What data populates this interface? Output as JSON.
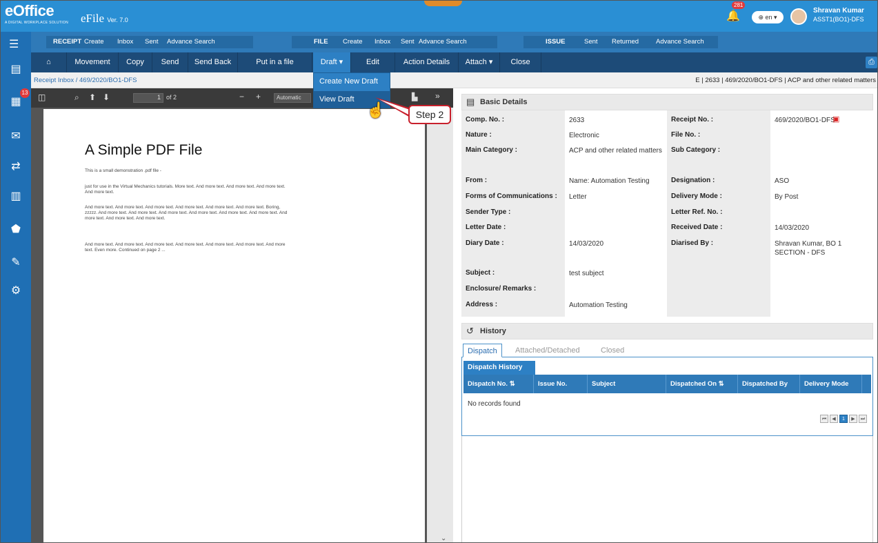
{
  "app": {
    "logo": "eOffice",
    "logo_tagline": "A DIGITAL WORKPLACE SOLUTION",
    "product": "eFile",
    "version": "Ver. 7.0",
    "notifications": "281",
    "language": "en",
    "user_name": "Shravan Kumar",
    "user_role": "ASST1(BO1)-DFS"
  },
  "nav": {
    "receipt": {
      "head": "RECEIPT",
      "items": [
        "Create",
        "Inbox",
        "Sent",
        "Advance Search"
      ]
    },
    "file": {
      "head": "FILE",
      "items": [
        "Create",
        "Inbox",
        "Sent",
        "Advance Search"
      ]
    },
    "issue": {
      "head": "ISSUE",
      "items": [
        "Sent",
        "Returned",
        "Advance Search"
      ]
    }
  },
  "toolbar": {
    "movement": "Movement",
    "copy": "Copy",
    "send": "Send",
    "send_back": "Send Back",
    "put_in_file": "Put in a file",
    "draft": "Draft",
    "edit": "Edit",
    "action_details": "Action Details",
    "attach": "Attach",
    "close": "Close"
  },
  "draft_menu": {
    "create": "Create New Draft",
    "view": "View Draft"
  },
  "callout": "Step 2",
  "breadcrumb": {
    "inbox": "Receipt Inbox",
    "sep": "/",
    "ref": "469/2020/BO1-DFS"
  },
  "ref_info": "E | 2633 | 469/2020/BO1-DFS | ACP and other related matters",
  "pdf": {
    "page": "1",
    "of": "of 2",
    "zoom": "Automatic",
    "title": "A Simple PDF File",
    "p1": "This is a small demonstration .pdf file -",
    "p2": "just for use in the Virtual Mechanics tutorials. More text. And more text. And more text. And more text. And more text.",
    "p3": "And more text. And more text. And more text. And more text. And more text. And more text. Boring, zzzzz. And more text. And more text. And more text. And more text. And more text. And more text. And more text. And more text. And more text.",
    "p4": "And more text. And more text. And more text. And more text. And more text. And more text. And more text. Even more. Continued on page 2 ..."
  },
  "basic": {
    "title": "Basic Details",
    "comp_no_l": "Comp. No. :",
    "comp_no": "2633",
    "receipt_no_l": "Receipt No. :",
    "receipt_no": "469/2020/BO1-DFS",
    "nature_l": "Nature :",
    "nature": "Electronic",
    "file_no_l": "File No. :",
    "main_cat_l": "Main Category :",
    "main_cat": "ACP and other related matters",
    "sub_cat_l": "Sub Category :",
    "from_l": "From :",
    "from": "Name: Automation Testing",
    "desig_l": "Designation :",
    "desig": "ASO",
    "forms_l": "Forms of Communications :",
    "forms": "Letter",
    "delivery_l": "Delivery Mode :",
    "delivery": "By Post",
    "sender_l": "Sender Type :",
    "letter_ref_l": "Letter Ref. No. :",
    "letter_date_l": "Letter Date :",
    "received_l": "Received Date :",
    "received": "14/03/2020",
    "diary_l": "Diary Date :",
    "diary": "14/03/2020",
    "diarised_l": "Diarised By :",
    "diarised": "Shravan Kumar, BO 1 SECTION - DFS",
    "subject_l": "Subject :",
    "subject": "test subject",
    "enclosure_l": "Enclosure/ Remarks :",
    "address_l": "Address :",
    "address": "Automation Testing"
  },
  "history": {
    "title": "History",
    "tabs": [
      "Dispatch",
      "Attached/Detached",
      "Closed"
    ],
    "tag": "Dispatch History",
    "cols": [
      "Dispatch No.",
      "Issue No.",
      "Subject",
      "Dispatched On",
      "Dispatched By",
      "Delivery Mode"
    ],
    "empty": "No records found",
    "page": "1"
  }
}
